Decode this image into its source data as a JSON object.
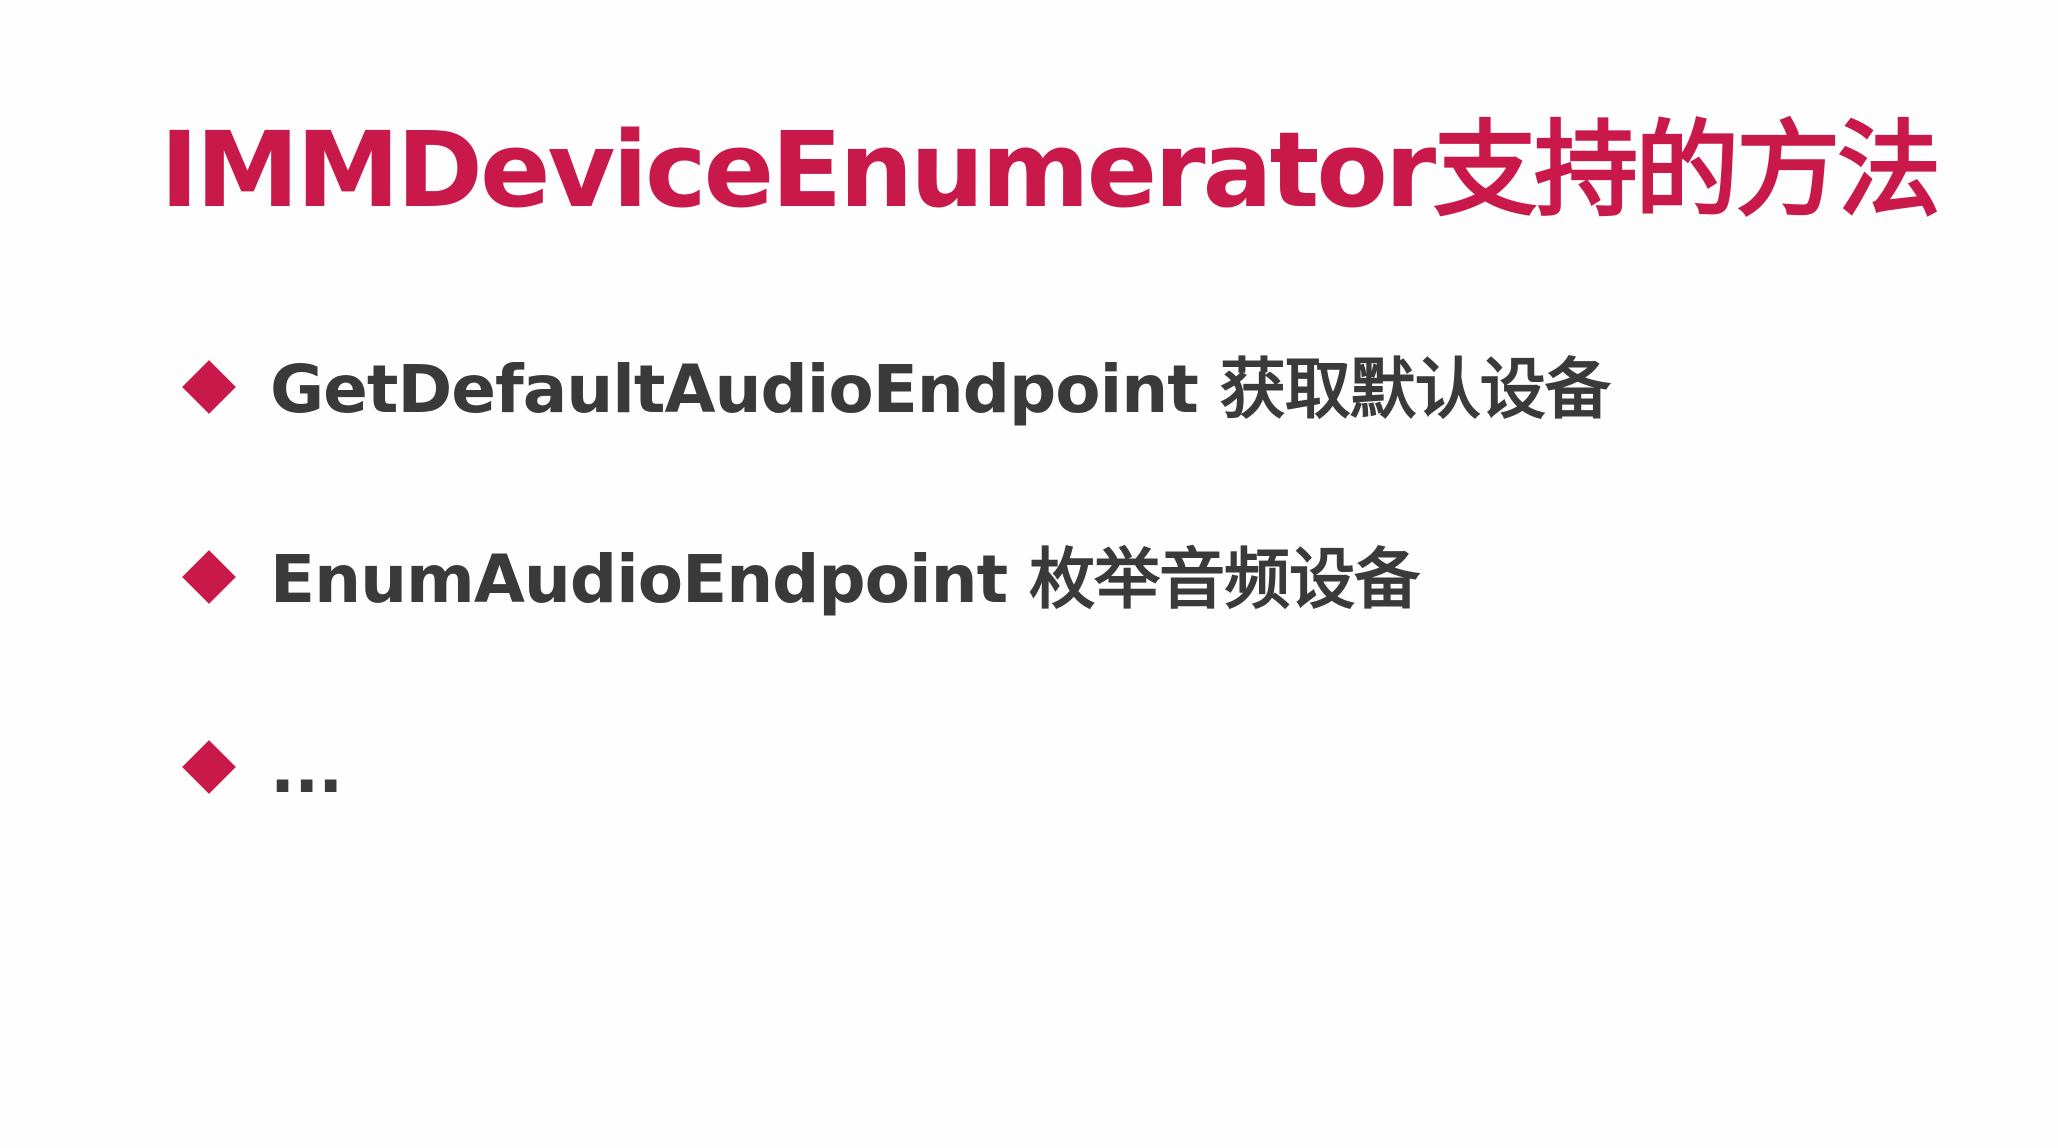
{
  "colors": {
    "accent": "#c9184a",
    "text": "#3a3a3a",
    "background": "#fefefe"
  },
  "slide": {
    "title": "IMMDeviceEnumerator支持的方法",
    "bullets": [
      {
        "icon": "diamond-bullet-icon",
        "text": "GetDefaultAudioEndpoint 获取默认设备"
      },
      {
        "icon": "diamond-bullet-icon",
        "text": "EnumAudioEndpoint 枚举音频设备"
      },
      {
        "icon": "diamond-bullet-icon",
        "text": "..."
      }
    ]
  }
}
